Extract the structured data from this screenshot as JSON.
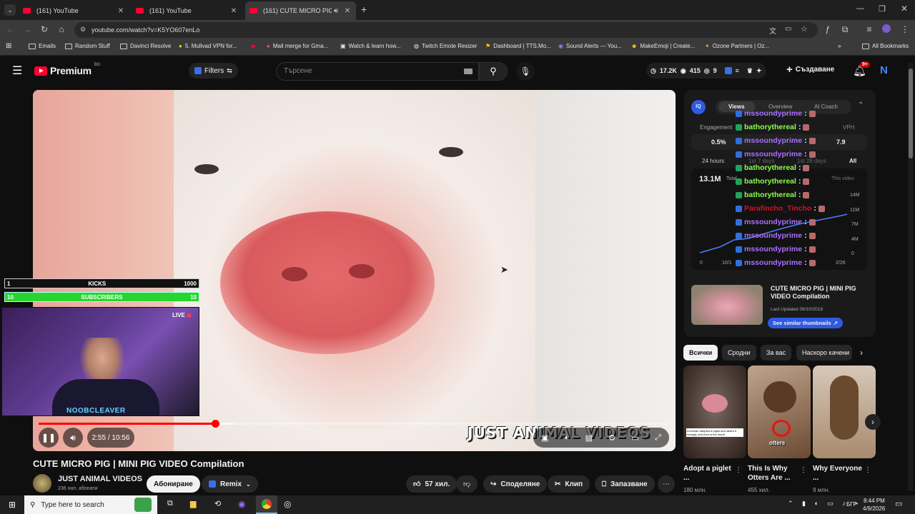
{
  "browser": {
    "tabs": [
      {
        "title": "(161) YouTube"
      },
      {
        "title": "(161) YouTube"
      },
      {
        "title": "(161) CUTE MICRO PIG | MI"
      }
    ],
    "url": "youtube.com/watch?v=K5YO607enLo",
    "bookmarks": [
      "Emails",
      "Random Stuff",
      "Davinci Resolve",
      "5. Mullvad VPN for...",
      "Mail merge for Gma...",
      "Watch & learn how...",
      "Twitch Emote Resizer",
      "Dashboard | TTS.Mo...",
      "Sound Alerts — You...",
      "MakeEmoji | Create...",
      "Ozone Partners | Oz..."
    ],
    "all_bookmarks": "All Bookmarks"
  },
  "header": {
    "logo": "Premium",
    "region": "BG",
    "filters": "Filters",
    "search_placeholder": "Търсене",
    "stats": {
      "a": "17.2K",
      "b": "415",
      "c": "9"
    },
    "create": "Създаване",
    "notif": "9+",
    "avatar": "N"
  },
  "video": {
    "time": "2:55 / 10:56",
    "progress": 0.28,
    "buffered": 0.31,
    "watermark": "JUST ANIMAL VIDEOS"
  },
  "overlay": {
    "kicks_left": "1",
    "kicks_label": "KICKS",
    "kicks_right": "1000",
    "subs_left": "10",
    "subs_label": "SUBSCRIBERS",
    "subs_right": "10",
    "live": "LIVE",
    "streamer": "NOOBCLEAVER"
  },
  "meta": {
    "title": "CUTE MICRO PIG | MINI PIG VIDEO Compilation",
    "channel": "JUST ANIMAL VIDEOS",
    "subs": "236 хил. абонати",
    "subscribe": "Абониране",
    "remix": "Remix",
    "likes": "57 хил.",
    "share": "Споделяне",
    "clip": "Клип",
    "save": "Запазване"
  },
  "iq": {
    "tabs": [
      "Views",
      "Overview",
      "AI Coach"
    ],
    "engagement": "Engagement",
    "vph": "VPH",
    "eng_val": "0.5%",
    "vph_val": "7.9",
    "range": [
      "24 hours",
      "1st 7 days",
      "1st 28 days",
      "All"
    ],
    "views": "13.1M",
    "total": "Total",
    "this_video": "This video",
    "yticks": [
      "14M",
      "11M",
      "7M",
      "4M",
      "0"
    ],
    "x0": "0",
    "x1": "10/1",
    "xend": "2/26",
    "card_title": "CUTE MICRO PIG | MINI PIG VIDEO Compilation",
    "card_updated": "Last Updated 06/10/2018",
    "see_similar": "See similar thumbnails"
  },
  "chat": [
    {
      "user": "mssoundyprime",
      "color": "#a970ff"
    },
    {
      "user": "bathorythereal",
      "color": "#8cff4d"
    },
    {
      "user": "mssoundyprime",
      "color": "#a970ff"
    },
    {
      "user": "mssoundyprime",
      "color": "#a970ff"
    },
    {
      "user": "bathorythereal",
      "color": "#8cff4d"
    },
    {
      "user": "bathorythereal",
      "color": "#8cff4d"
    },
    {
      "user": "bathorythereal",
      "color": "#8cff4d"
    },
    {
      "user": "Parafincho_Tincho",
      "color": "#d4122b"
    },
    {
      "user": "mssoundyprime",
      "color": "#a970ff"
    },
    {
      "user": "mssoundyprime",
      "color": "#a970ff"
    },
    {
      "user": "mssoundyprime",
      "color": "#a970ff"
    },
    {
      "user": "mssoundyprime",
      "color": "#a970ff"
    }
  ],
  "chips": [
    "Всички",
    "Сродни",
    "За вас",
    "Наскоро качени"
  ],
  "recs": [
    {
      "title": "Adopt a piglet ...",
      "views": "180 млн.",
      "thumb_text": "A woman adopted a piglet and raised it lovingly, and here is the result"
    },
    {
      "title": "This Is Why Otters Are ...",
      "views": "455 хил.",
      "thumb_text": "otters"
    },
    {
      "title": "Why Everyone ...",
      "views": "9 млн.",
      "thumb_text": ""
    }
  ],
  "taskbar": {
    "search": "Type here to search",
    "lang": "БГР",
    "time": "8:44 PM",
    "date": "4/9/2026"
  }
}
